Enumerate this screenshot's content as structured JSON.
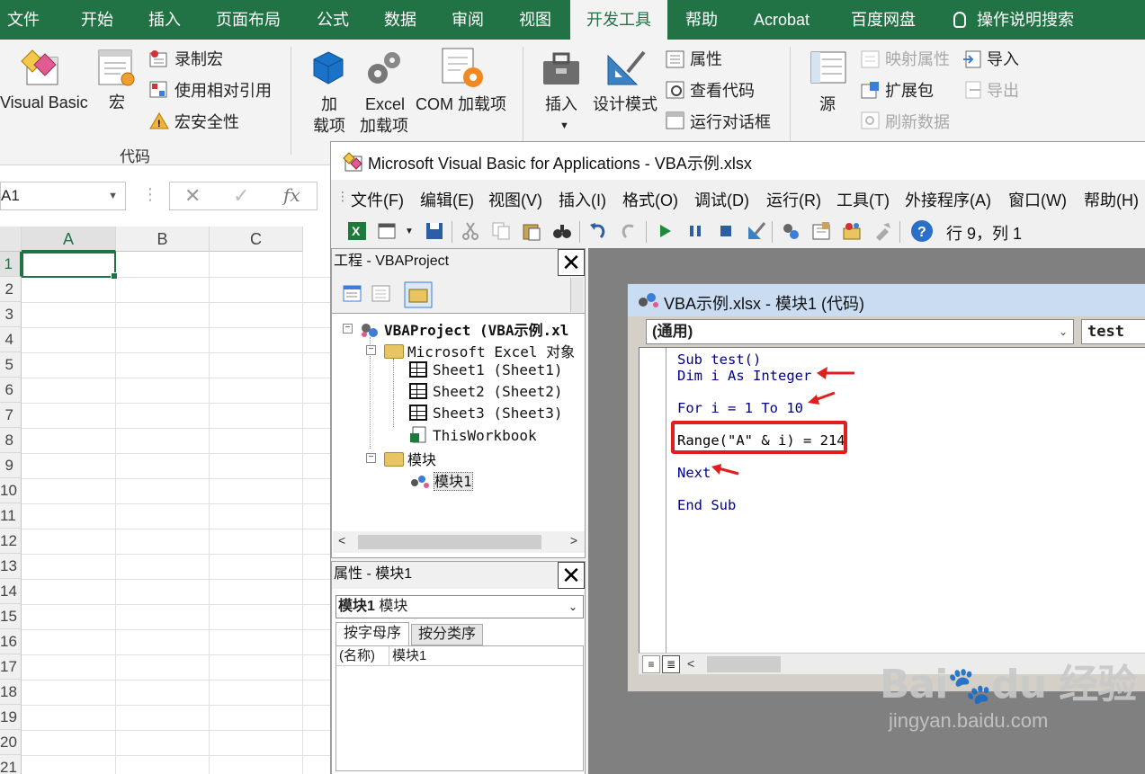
{
  "ribbon_tabs": [
    "文件",
    "开始",
    "插入",
    "页面布局",
    "公式",
    "数据",
    "审阅",
    "视图",
    "开发工具",
    "帮助",
    "Acrobat",
    "百度网盘",
    "操作说明搜索"
  ],
  "active_tab": "开发工具",
  "ribbon": {
    "visual_basic": "Visual Basic",
    "macros": "宏",
    "record_macro": "录制宏",
    "relative_ref": "使用相对引用",
    "macro_security": "宏安全性",
    "code_group": "代码",
    "addins_line1": "加",
    "addins_line2": "载项",
    "excel_addins_line1": "Excel",
    "excel_addins_line2": "加载项",
    "com_addins": "COM 加载项",
    "insert": "插入",
    "design_mode": "设计模式",
    "properties": "属性",
    "view_code": "查看代码",
    "run_dialog": "运行对话框",
    "source": "源",
    "map_properties": "映射属性",
    "expansion_packs": "扩展包",
    "refresh_data": "刷新数据",
    "import": "导入",
    "export": "导出"
  },
  "formula_bar": {
    "name_box": "A1",
    "fx": "fx"
  },
  "grid": {
    "columns": [
      "A",
      "B",
      "C"
    ],
    "rows": [
      "1",
      "2",
      "3",
      "4",
      "5",
      "6",
      "7",
      "8",
      "9",
      "10",
      "11",
      "12",
      "13",
      "14",
      "15",
      "16",
      "17",
      "18",
      "19",
      "20",
      "21"
    ]
  },
  "vbe": {
    "title": "Microsoft Visual Basic for Applications - VBA示例.xlsx",
    "menu": [
      "文件(F)",
      "编辑(E)",
      "视图(V)",
      "插入(I)",
      "格式(O)",
      "调试(D)",
      "运行(R)",
      "工具(T)",
      "外接程序(A)",
      "窗口(W)",
      "帮助(H)"
    ],
    "status": "行 9，列 1",
    "project_pane": {
      "title": "工程 - VBAProject",
      "root": "VBAProject (VBA示例.xl",
      "excel_objects": "Microsoft Excel 对象",
      "sheets": [
        "Sheet1 (Sheet1)",
        "Sheet2 (Sheet2)",
        "Sheet3 (Sheet3)",
        "ThisWorkbook"
      ],
      "modules_folder": "模块",
      "module": "模块1"
    },
    "properties_pane": {
      "title": "属性 - 模块1",
      "object_name": "模块1",
      "object_type": "模块",
      "tab_alpha": "按字母序",
      "tab_category": "按分类序",
      "prop_name": "(名称)",
      "prop_value": "模块1"
    },
    "code_window": {
      "title": "VBA示例.xlsx - 模块1 (代码)",
      "object_combo": "(通用)",
      "proc_combo": "test",
      "lines": {
        "l1_kw": "Sub",
        "l1_rest": " test()",
        "l2_kw": "Dim",
        "l2_mid": " i ",
        "l2_kw2": "As",
        "l2_sp": " ",
        "l2_kw3": "Integer",
        "l3_kw": "For",
        "l3_mid": " i = 1 ",
        "l3_kw2": "To",
        "l3_rest": " 10",
        "l4": "Range(\"A\" & i) = 214",
        "l5_kw": "Next",
        "l6_kw": "End Sub"
      }
    }
  },
  "watermark": {
    "logo": "Bai du 经验",
    "url": "jingyan.baidu.com"
  },
  "colors": {
    "excel_green": "#217346",
    "vba_keyword": "#00008b",
    "highlight_red": "#e21d1d"
  }
}
